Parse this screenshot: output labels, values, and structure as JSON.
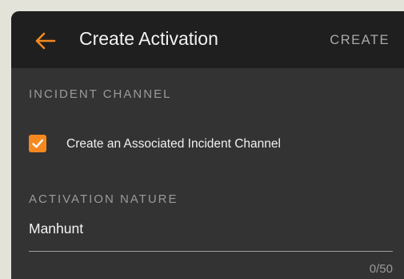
{
  "appbar": {
    "title": "Create Activation",
    "action_label": "CREATE",
    "back_icon": "arrow-left-icon",
    "accent_color": "#f5891f"
  },
  "incident_channel": {
    "section_label": "INCIDENT CHANNEL",
    "checkbox_label": "Create an Associated Incident Channel",
    "checked": true
  },
  "activation_nature": {
    "section_label": "ACTIVATION NATURE",
    "value": "Manhunt",
    "counter": "0/50"
  }
}
